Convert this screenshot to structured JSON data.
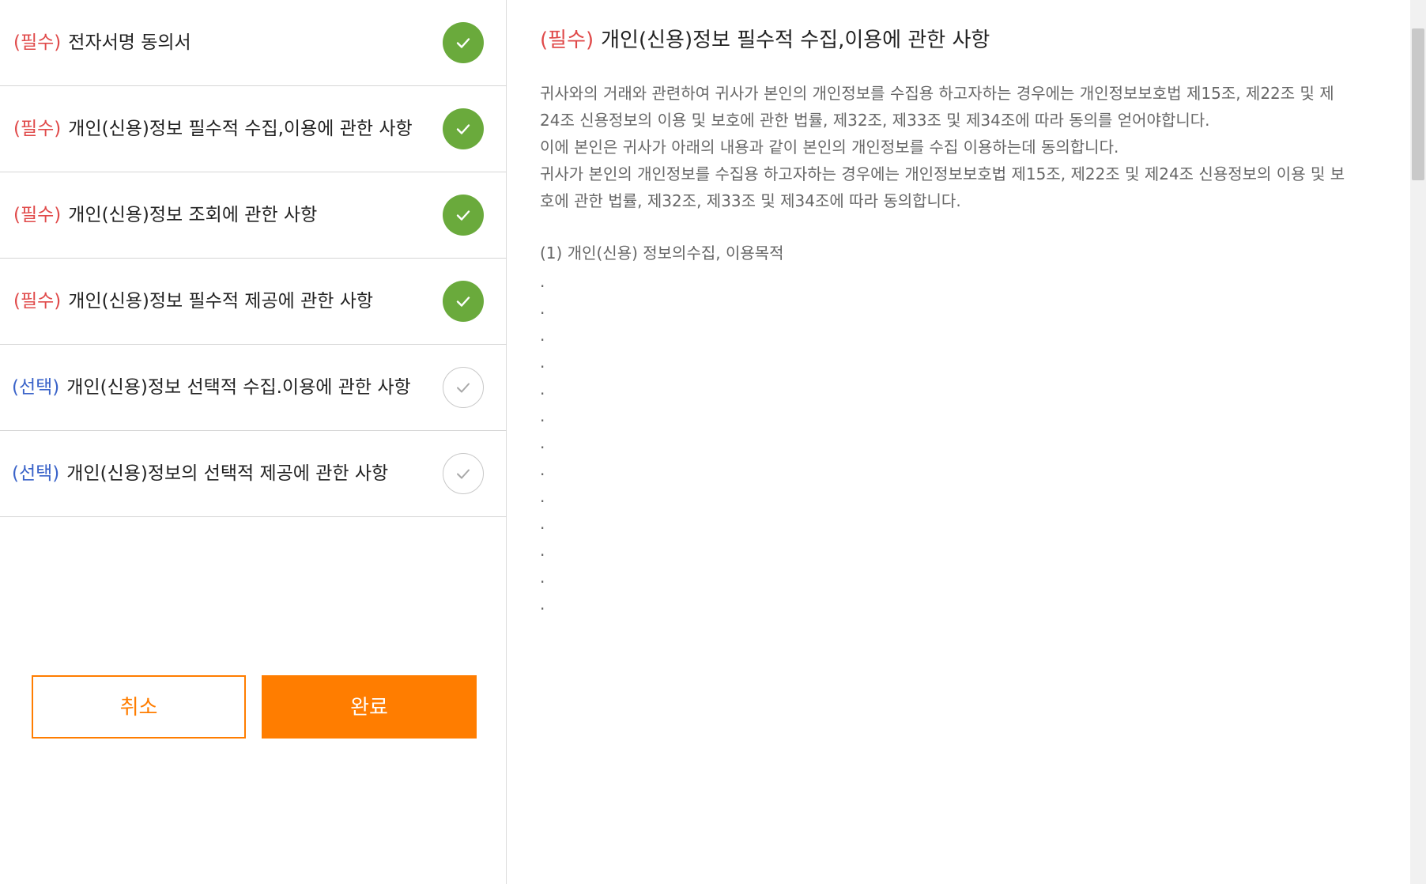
{
  "consents": [
    {
      "tag": "(필수)",
      "label": "전자서명 동의서",
      "checked": true,
      "required": true
    },
    {
      "tag": "(필수)",
      "label": "개인(신용)정보 필수적 수집,이용에 관한 사항",
      "checked": true,
      "required": true
    },
    {
      "tag": "(필수)",
      "label": "개인(신용)정보 조회에 관한 사항",
      "checked": true,
      "required": true
    },
    {
      "tag": "(필수)",
      "label": "개인(신용)정보 필수적 제공에 관한 사항",
      "checked": true,
      "required": true
    },
    {
      "tag": "(선택)",
      "label": "개인(신용)정보 선택적 수집.이용에 관한 사항",
      "checked": false,
      "required": false
    },
    {
      "tag": "(선택)",
      "label": "개인(신용)정보의 선택적 제공에 관한 사항",
      "checked": false,
      "required": false
    }
  ],
  "buttons": {
    "cancel": "취소",
    "done": "완료"
  },
  "detail": {
    "tag": "(필수)",
    "title": "개인(신용)정보 필수적 수집,이용에 관한 사항",
    "paragraphs": [
      "귀사와의 거래와 관련하여 귀사가 본인의 개인정보를 수집용 하고자하는 경우에는 개인정보보호법 제15조, 제22조 및 제24조 신용정보의 이용 및 보호에 관한 법률, 제32조, 제33조 및 제34조에 따라 동의를 얻어야합니다.",
      "이에 본인은 귀사가 아래의 내용과 같이 본인의 개인정보를 수집 이용하는데 동의합니다.",
      "귀사가 본인의 개인정보를 수집용 하고자하는 경우에는 개인정보보호법 제15조, 제22조 및 제24조 신용정보의 이용 및 보호에 관한 법률, 제32조, 제33조 및 제34조에 따라 동의합니다."
    ],
    "section1": "(1) 개인(신용) 정보의수집, 이용목적",
    "dots": [
      ".",
      ".",
      ".",
      ".",
      ".",
      ".",
      ".",
      ".",
      ".",
      ".",
      ".",
      ".",
      "."
    ]
  },
  "colors": {
    "required_tag": "#e04a4a",
    "optional_tag": "#3a63c9",
    "check_on": "#6aaa3c",
    "accent": "#ff7d00"
  },
  "icons": {
    "check": "check-icon"
  }
}
